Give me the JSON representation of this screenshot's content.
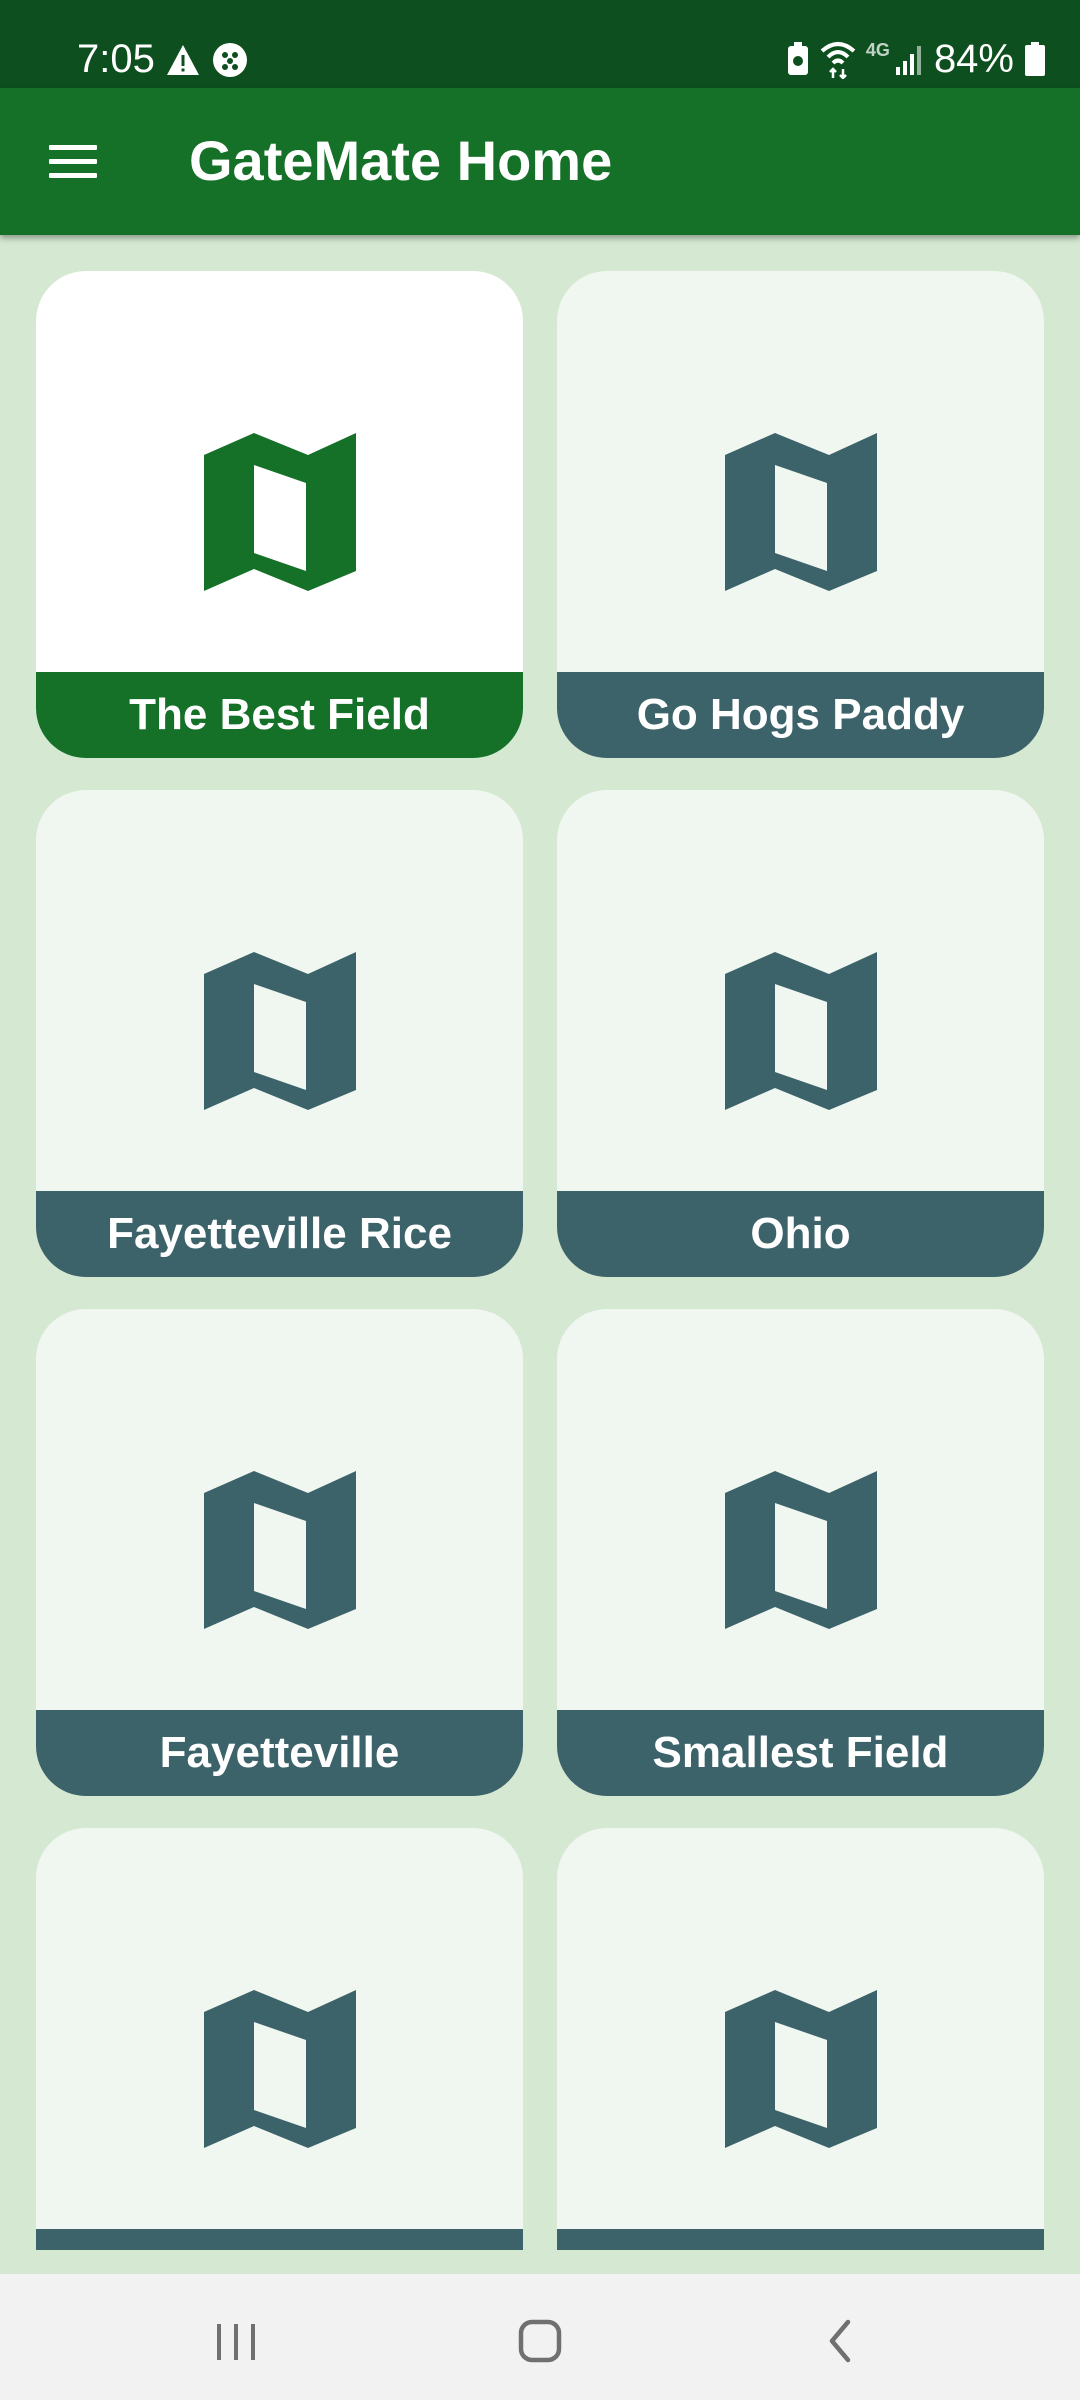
{
  "status_bar": {
    "time": "7:05",
    "network": "4G",
    "battery": "84%"
  },
  "app_bar": {
    "title": "GateMate Home",
    "menu_icon": "hamburger-menu-icon"
  },
  "colors": {
    "status_bar": "#0d4f1e",
    "app_bar": "#157028",
    "background": "#d5e8d1",
    "card": "#f0f6f0",
    "card_label": "#3c6369",
    "selected_accent": "#157028"
  },
  "fields": [
    {
      "name": "The Best Field",
      "icon": "map-icon",
      "selected": true
    },
    {
      "name": "Go Hogs Paddy",
      "icon": "map-icon",
      "selected": false
    },
    {
      "name": "Fayetteville Rice",
      "icon": "map-icon",
      "selected": false
    },
    {
      "name": "Ohio",
      "icon": "map-icon",
      "selected": false
    },
    {
      "name": "Fayetteville",
      "icon": "map-icon",
      "selected": false
    },
    {
      "name": "Smallest Field",
      "icon": "map-icon",
      "selected": false
    },
    {
      "name": "",
      "icon": "map-icon",
      "selected": false
    },
    {
      "name": "",
      "icon": "map-icon",
      "selected": false
    }
  ],
  "nav_bar": {
    "recents_icon": "recent-apps-icon",
    "home_icon": "home-icon",
    "back_icon": "back-icon"
  }
}
